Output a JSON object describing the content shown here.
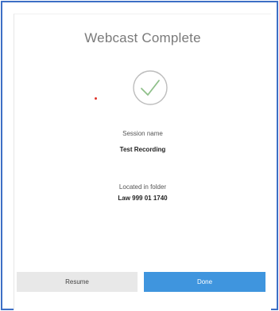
{
  "dialog": {
    "title": "Webcast Complete",
    "status_icon": "checkmark-circle-icon",
    "session": {
      "label": "Session name",
      "value": "Test Recording"
    },
    "folder": {
      "label": "Located in folder",
      "value": "Law 999 01 1740"
    },
    "buttons": {
      "resume_label": "Resume",
      "done_label": "Done"
    }
  },
  "colors": {
    "frame_border": "#3d6fc5",
    "check_color": "#8fc08a",
    "ring_color": "#bdbdbd",
    "done_button": "#3f95de",
    "resume_button": "#e8e8e8",
    "marker_dot": "#e0342a"
  }
}
